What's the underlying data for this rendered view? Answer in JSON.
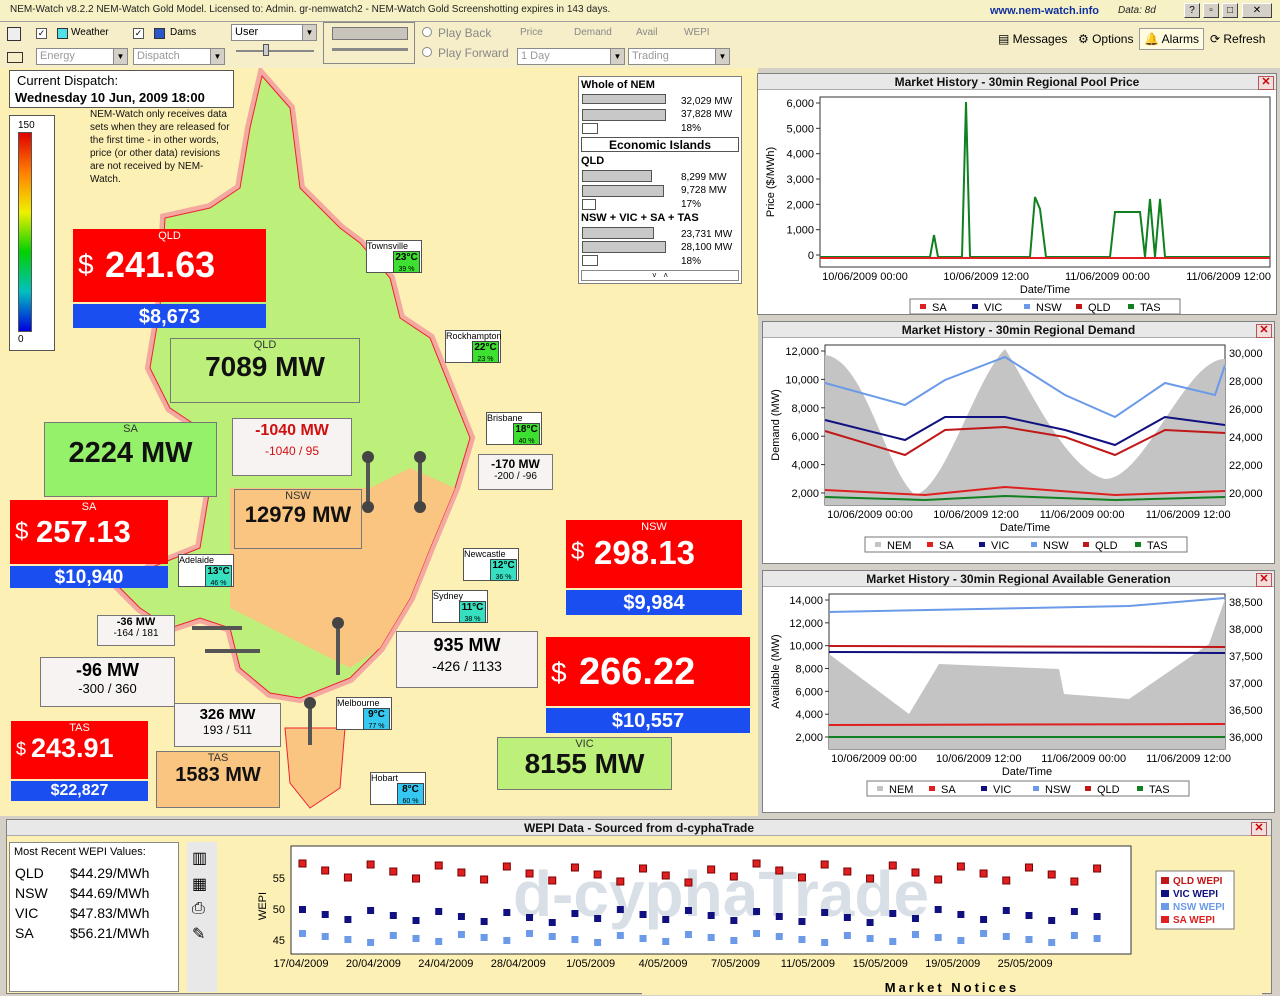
{
  "titlebar": {
    "text": "NEM-Watch v8.2.2 NEM-Watch Gold Model.     Licensed to: Admin.  gr-nemwatch2 - NEM-Watch Gold Screenshotting expires in 143 days.",
    "url": "www.nem-watch.info",
    "data": "Data: 8d"
  },
  "toolbar": {
    "weather": "Weather",
    "dams": "Dams",
    "view": "User",
    "energy": "Energy",
    "dispatch": "Dispatch",
    "playback": "Play Back",
    "playforward": "Play Forward",
    "price": "Price",
    "demand": "Demand",
    "avail": "Avail",
    "wepi": "WEPI",
    "period": "1 Day",
    "mode": "Trading",
    "messages": "Messages",
    "options": "Options",
    "alarms": "Alarms",
    "refresh": "Refresh"
  },
  "dispatch": {
    "label": "Current Dispatch:",
    "datetime": "Wednesday 10 Jun, 2009 18:00"
  },
  "scale": {
    "max": "150",
    "min": "0"
  },
  "note": "NEM-Watch only receives data sets when they are released for the first time - in other words, price (or other data) revisions are not received by NEM-Watch.",
  "nem": {
    "title": "Whole of NEM",
    "v1": "32,029 MW",
    "v2": "37,828 MW",
    "v3": "18%",
    "islands": "Economic Islands",
    "qld": "QLD",
    "q1": "8,299 MW",
    "q2": "9,728 MW",
    "q3": "17%",
    "south": "NSW + VIC + SA + TAS",
    "s1": "23,731 MW",
    "s2": "28,100 MW",
    "s3": "18%"
  },
  "regions": {
    "qld": {
      "label": "QLD",
      "price": "241.63",
      "cap": "$8,673",
      "mw": "7089 MW"
    },
    "sa": {
      "label": "SA",
      "price": "257.13",
      "cap": "$10,940",
      "mw": "2224 MW"
    },
    "nsw": {
      "label": "NSW",
      "price": "298.13",
      "cap": "$9,984",
      "mw": "12979 MW"
    },
    "vic": {
      "label": "VIC",
      "price": "266.22",
      "cap": "$10,557",
      "mw": "8155 MW"
    },
    "tas": {
      "label": "TAS",
      "price": "243.91",
      "cap": "$22,827",
      "mw": "1583 MW"
    }
  },
  "currency": "$",
  "flows": {
    "qni": {
      "val": "-1040 MW",
      "lim": "-1040 / 95"
    },
    "dl": {
      "val": "-170 MW",
      "lim": "-200 / -96"
    },
    "ml": {
      "val": "-36 MW",
      "lim": "-164 / 181"
    },
    "hv": {
      "val": "-96 MW",
      "lim": "-300 / 360"
    },
    "vn": {
      "val": "935 MW",
      "lim": "-426 / 1133"
    },
    "bl": {
      "val": "326 MW",
      "lim": "193 / 511"
    }
  },
  "cities": {
    "townsville": {
      "name": "Townsville",
      "t": "23°C",
      "h": "39 %"
    },
    "rockhampton": {
      "name": "Rockhampton",
      "t": "22°C",
      "h": "23 %"
    },
    "brisbane": {
      "name": "Brisbane",
      "t": "18°C",
      "h": "40 %"
    },
    "newcastle": {
      "name": "Newcastle",
      "t": "12°C",
      "h": "36 %"
    },
    "sydney": {
      "name": "Sydney",
      "t": "11°C",
      "h": "38 %"
    },
    "adelaide": {
      "name": "Adelaide",
      "t": "13°C",
      "h": "46 %"
    },
    "melbourne": {
      "name": "Melbourne",
      "t": "9°C",
      "h": "77 %"
    },
    "hobart": {
      "name": "Hobart",
      "t": "8°C",
      "h": "60 %"
    }
  },
  "charts": {
    "price": {
      "title": "Market History - 30min Regional Pool Price",
      "ylabel": "Price ($/MWh)",
      "xlabel": "Date/Time",
      "yticks": [
        "6,000",
        "5,000",
        "4,000",
        "3,000",
        "2,000",
        "1,000",
        "0"
      ],
      "xticks": [
        "10/06/2009 00:00",
        "10/06/2009 12:00",
        "11/06/2009 00:00",
        "11/06/2009 12:00"
      ],
      "legend": [
        "SA",
        "VIC",
        "NSW",
        "QLD",
        "TAS"
      ]
    },
    "demand": {
      "title": "Market History - 30min Regional Demand",
      "ylabel": "Demand (MW)",
      "xlabel": "Date/Time",
      "yticks": [
        "12,000",
        "10,000",
        "8,000",
        "6,000",
        "4,000",
        "2,000"
      ],
      "y2ticks": [
        "30,000",
        "28,000",
        "26,000",
        "24,000",
        "22,000",
        "20,000"
      ],
      "xticks": [
        "10/06/2009 00:00",
        "10/06/2009 12:00",
        "11/06/2009 00:00",
        "11/06/2009 12:00"
      ],
      "legend": [
        "NEM",
        "SA",
        "VIC",
        "NSW",
        "QLD",
        "TAS"
      ]
    },
    "avail": {
      "title": "Market History - 30min Regional Available Generation",
      "ylabel": "Available (MW)",
      "xlabel": "Date/Time",
      "yticks": [
        "14,000",
        "12,000",
        "10,000",
        "8,000",
        "6,000",
        "4,000",
        "2,000"
      ],
      "y2ticks": [
        "38,500",
        "38,000",
        "37,500",
        "37,000",
        "36,500",
        "36,000"
      ],
      "xticks": [
        "10/06/2009 00:00",
        "10/06/2009 12:00",
        "11/06/2009 00:00",
        "11/06/2009 12:00"
      ],
      "legend": [
        "NEM",
        "SA",
        "VIC",
        "NSW",
        "QLD",
        "TAS"
      ]
    }
  },
  "wepi": {
    "title": "WEPI Data - Sourced from d-cyphaTrade",
    "recent": "Most Recent WEPI Values:",
    "rows": [
      {
        "r": "QLD",
        "v": "$44.29/MWh"
      },
      {
        "r": "NSW",
        "v": "$44.69/MWh"
      },
      {
        "r": "VIC",
        "v": "$47.83/MWh"
      },
      {
        "r": "SA",
        "v": "$56.21/MWh"
      }
    ],
    "ylabel": "WEPI",
    "yticks": [
      "55",
      "50",
      "45"
    ],
    "xticks": [
      "17/04/2009",
      "20/04/2009",
      "24/04/2009",
      "28/04/2009",
      "1/05/2009",
      "4/05/2009",
      "7/05/2009",
      "11/05/2009",
      "15/05/2009",
      "19/05/2009",
      "25/05/2009"
    ],
    "legend": [
      "QLD WEPI",
      "VIC WEPI",
      "NSW WEPI",
      "SA WEPI"
    ],
    "watermark": "d-cyphaTrade",
    "notices": "Market Notices"
  },
  "colors": {
    "SA": "#e02020",
    "VIC": "#101080",
    "NSW": "#6a9ae8",
    "QLD": "#c01818",
    "TAS": "#108020",
    "NEM": "#c4c4c4"
  }
}
